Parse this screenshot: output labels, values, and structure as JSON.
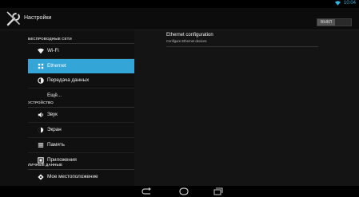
{
  "status_bar": {
    "time": "10:04",
    "wifi_icon": "wifi-signal-icon"
  },
  "action_bar": {
    "title": "Настройки",
    "app_icon": "settings-tools-icon",
    "toggle_label": "ВЫКЛ"
  },
  "sidebar": {
    "sections": [
      {
        "header": "БЕСПРОВОДНЫЕ СЕТИ"
      },
      {
        "header": "УСТРОЙСТВО"
      },
      {
        "header": "ЛИЧНЫЕ ДАННЫЕ"
      }
    ],
    "items": [
      {
        "label": "Wi-Fi",
        "icon": "wifi-icon"
      },
      {
        "label": "Ethernet",
        "icon": "ethernet-icon",
        "active": true
      },
      {
        "label": "Передача данных",
        "icon": "data-usage-icon"
      },
      {
        "label": "Ещё...",
        "icon": ""
      },
      {
        "label": "Звук",
        "icon": "sound-icon"
      },
      {
        "label": "Экран",
        "icon": "display-icon"
      },
      {
        "label": "Память",
        "icon": "storage-icon"
      },
      {
        "label": "Приложения",
        "icon": "apps-icon"
      },
      {
        "label": "Мое местоположение",
        "icon": "location-icon"
      }
    ]
  },
  "detail": {
    "title": "Ethernet configuration",
    "subtitle": "Configure Ethernet devices"
  },
  "colors": {
    "accent": "#33a5d6",
    "clock": "#33b5e5",
    "background": "#000000"
  },
  "navigation": [
    "back-icon",
    "home-icon",
    "recent-apps-icon"
  ]
}
